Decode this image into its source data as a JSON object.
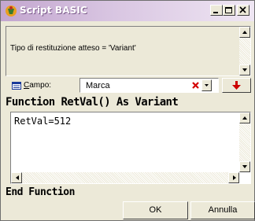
{
  "window": {
    "title": "Script BASIC",
    "controls": [
      "minimize-icon",
      "maximize-icon",
      "close-icon"
    ]
  },
  "info": {
    "text": "Tipo di restituzione atteso = 'Variant'"
  },
  "field": {
    "label_underlined": "C",
    "label_rest": "ampo:",
    "value": "Marca",
    "icons": [
      "field-icon",
      "clear-icon",
      "dropdown-arrow-icon",
      "insert-down-arrow-icon"
    ]
  },
  "code": {
    "header": "Function RetVal() As Variant",
    "body": "RetVal=512",
    "footer": "End Function"
  },
  "buttons": {
    "ok": "OK",
    "cancel": "Annulla"
  },
  "colors": {
    "titlebar_start": "#c3a6cf",
    "titlebar_end": "#efe6f3",
    "dialog_bg": "#ece9d8",
    "clear_icon": "#d40000",
    "insert_arrow": "#cc0000"
  }
}
